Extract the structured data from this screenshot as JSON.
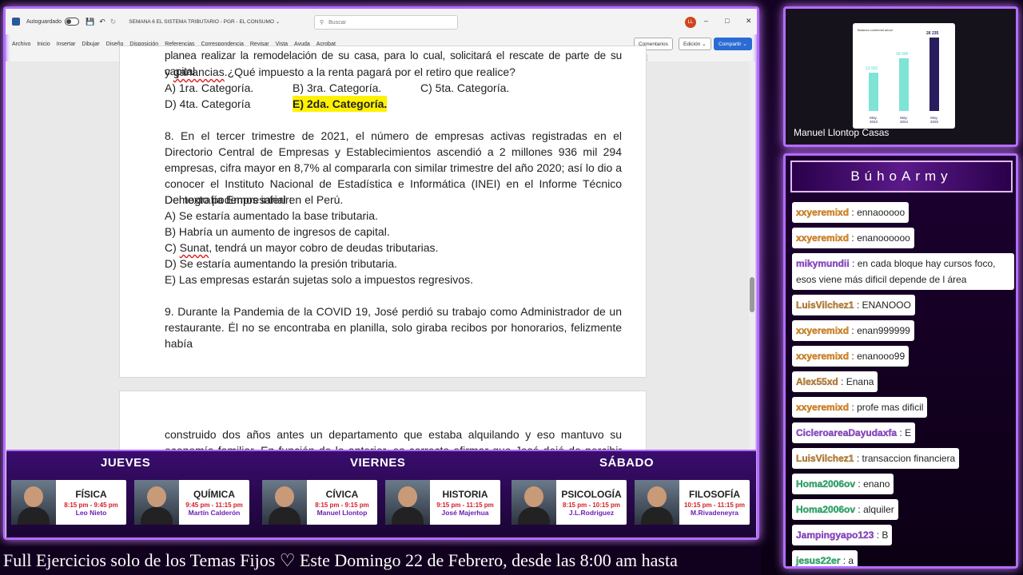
{
  "word": {
    "autosave_label": "Autoguardado",
    "doc_title": "SEMANA 6 EL SISTEMA TRIBUTARIO - PGR - EL CONSUMO ⌄",
    "search_placeholder": "Buscar",
    "user_initials": "LL",
    "menus": [
      "Archivo",
      "Inicio",
      "Insertar",
      "Dibujar",
      "Diseño",
      "Disposición",
      "Referencias",
      "Correspondencia",
      "Revisar",
      "Vista",
      "Ayuda",
      "Acrobat"
    ],
    "comments_label": "Comentarios",
    "editing_label": "Edición ⌄",
    "share_label": "Compartir ⌄"
  },
  "doc": {
    "line_q7_a": "planea realizar la remodelación de su casa, para lo cual, solicitará el rescate de parte de su capital",
    "line_q7_b_pre": "y ",
    "line_q7_b_word": "ganancias",
    "line_q7_b_post": ".¿Qué impuesto a la renta pagará por el retiro que realice?",
    "opt_a": "A) 1ra. Categoría.",
    "opt_b": "B) 3ra. Categoría.",
    "opt_c": "C) 5ta. Categoría.",
    "opt_d": "D) 4ta. Categoría",
    "opt_e": "E) 2da. Categoría.",
    "q8_para": "8. En el tercer trimestre de 2021, el número de empresas activas registradas en el Directorio Central de Empresas y Establecimientos ascendió a 2 millones 936 mil 294 empresas, cifra mayor en 8,7% al compararla con similar trimestre del año 2020; así lo dio a conocer el Instituto Nacional de Estadística e Informática (INEI) en el Informe Técnico Demografía Empresarial en el Perú.",
    "q8_infer": "Del texto podemos inferir:",
    "q8_a": "A) Se estaría aumentado la base tributaria.",
    "q8_b": "B) Habría un aumento de ingresos de capital.",
    "q8_c_pre": "C) ",
    "q8_c_word": "Sunat",
    "q8_c_post": ", tendrá un mayor cobro de deudas tributarias.",
    "q8_d": "D) Se estaría aumentando la presión tributaria.",
    "q8_e": "E) Las empresas estarán sujetas solo a impuestos regresivos.",
    "q9_para": "9. Durante la Pandemia de la COVID 19, José perdió su trabajo como Administrador de un restaurante. Él no se encontraba en planilla, solo giraba recibos por honorarios, felizmente había",
    "p2_para": "construido dos años antes un departamento que estaba alquilando y eso mantuvo su economía familiar. En función de lo anterior, es correcto afirmar que José dejó de percibir ingresos por"
  },
  "schedule": {
    "days": [
      "JUEVES",
      "VIERNES",
      "SÁBADO"
    ],
    "cards": [
      {
        "subject": "FÍSICA",
        "time": "8:15 pm - 9:45 pm",
        "teacher": "Leo Nieto"
      },
      {
        "subject": "QUÍMICA",
        "time": "9:45 pm - 11:15 pm",
        "teacher": "Martín Calderón"
      },
      {
        "subject": "CÍVICA",
        "time": "8:15 pm - 9:15 pm",
        "teacher": "Manuel Llontop"
      },
      {
        "subject": "HISTORIA",
        "time": "9:15 pm - 11:15 pm",
        "teacher": "José Majerhua"
      },
      {
        "subject": "PSICOLOGÍA",
        "time": "8:15 pm - 10:15 pm",
        "teacher": "J.L.Rodriguez"
      },
      {
        "subject": "FILOSOFÍA",
        "time": "10:15 pm - 11:15 pm",
        "teacher": "M.Rivadeneyra"
      }
    ]
  },
  "ticker": "Full Ejercicios solo de los Temas Fijos ♡     Este Domingo 22 de Febrero, desde las 8:00 am hasta",
  "cam": {
    "name": "Manuel Llontop Casas",
    "chart_title": "Balanza comercial anual",
    "bars": [
      {
        "label": "May. 2023",
        "value": "12 501"
      },
      {
        "label": "May. 2024",
        "value": "18 045"
      },
      {
        "label": "May. 2025",
        "value": "26 235"
      }
    ]
  },
  "chat": {
    "title": "BúhoArmy",
    "messages": [
      {
        "user": "xxyeremixd",
        "text": "ennaooooo",
        "color": "orange"
      },
      {
        "user": "xxyeremixd",
        "text": "enanoooooo",
        "color": "orange"
      },
      {
        "user": "mikymundii",
        "text": "en cada bloque hay cursos foco, esos viene más dificil depende de l área",
        "color": "purple"
      },
      {
        "user": "LuisVilchez1",
        "text": "ENANOOO",
        "color": "tan"
      },
      {
        "user": "xxyeremixd",
        "text": "enan999999",
        "color": "orange"
      },
      {
        "user": "xxyeremixd",
        "text": "enanooo99",
        "color": "orange"
      },
      {
        "user": "Alex55xd",
        "text": "Enana",
        "color": "tan"
      },
      {
        "user": "xxyeremixd",
        "text": "profe mas dificil",
        "color": "orange"
      },
      {
        "user": "CicleroareaDayudaxfa",
        "text": "E",
        "color": "purple"
      },
      {
        "user": "LuisVilchez1",
        "text": "transaccion financiera",
        "color": "tan"
      },
      {
        "user": "Homa2006ov",
        "text": "enano",
        "color": "green"
      },
      {
        "user": "Homa2006ov",
        "text": "alquiler",
        "color": "green"
      },
      {
        "user": "Jampingyapo123",
        "text": "B",
        "color": "purple"
      },
      {
        "user": "jesus22er",
        "text": "a",
        "color": "green"
      }
    ]
  }
}
